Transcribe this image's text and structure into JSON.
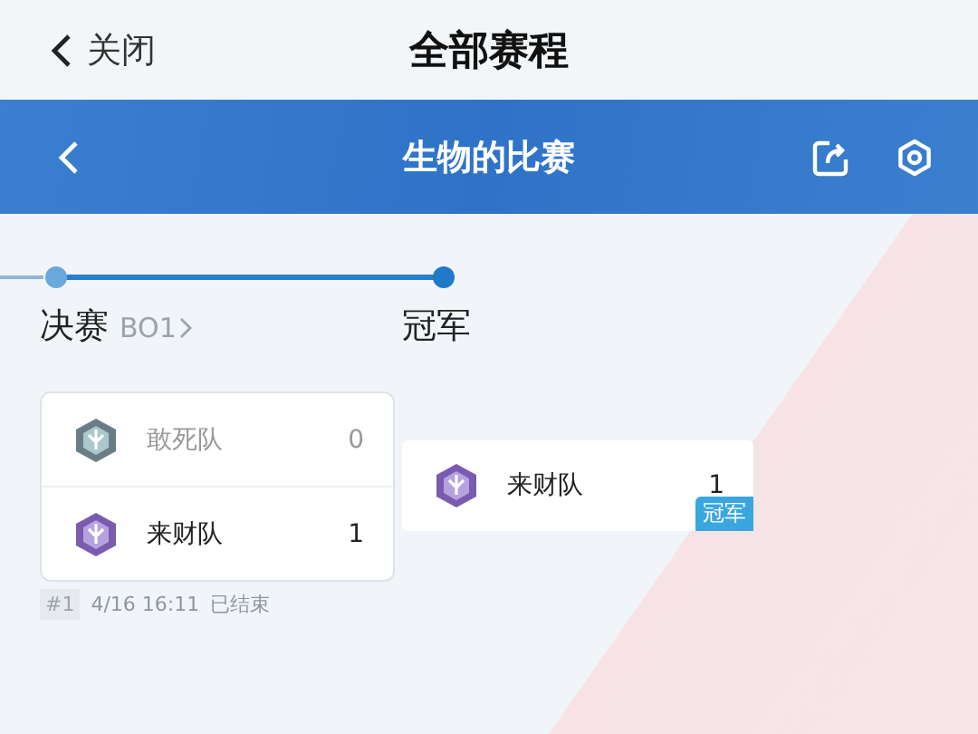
{
  "header": {
    "close_label": "关闭",
    "title": "全部赛程"
  },
  "banner": {
    "title": "生物的比赛"
  },
  "stages": [
    {
      "label": "决赛",
      "format": "BO1"
    },
    {
      "label": "冠军"
    }
  ],
  "match": {
    "teams": [
      {
        "name": "敢死队",
        "score": "0",
        "winner": false
      },
      {
        "name": "来财队",
        "score": "1",
        "winner": true
      }
    ],
    "number": "#1",
    "time": "4/16 16:11",
    "status": "已结束"
  },
  "champion": {
    "name": "来财队",
    "score": "1",
    "badge": "冠军"
  }
}
